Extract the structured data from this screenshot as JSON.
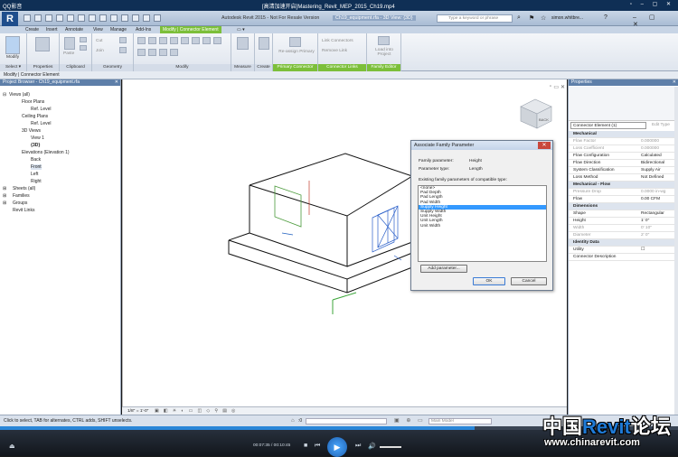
{
  "player": {
    "title": "[高清加速开启]Mastering_Revit_MEP_2015_Ch19.mp4",
    "logo": "QQ影音",
    "time": "00:07:35 / 00:10:45",
    "progress": 0.7
  },
  "revit": {
    "title": "Autodesk Revit 2015 - Not For Resale Version",
    "file_title": "Ch19_equipment.rfa - 3D View: {3D}",
    "search_placeholder": "Type a keyword or phrase",
    "user": "simon.whitbre..."
  },
  "ribbon": {
    "tabs": [
      "Create",
      "Insert",
      "Annotate",
      "View",
      "Manage",
      "Add-Ins",
      "Modify | Connector Element"
    ],
    "panels": {
      "select": "Select ▾",
      "properties": "Properties",
      "clipboard": "Clipboard",
      "geometry": "Geometry",
      "modify": "Modify",
      "measure": "Measure",
      "create": "Create",
      "primary_connector": "Primary Connector",
      "connector_links": "Connector Links",
      "family_editor": "Family Editor"
    },
    "buttons": {
      "modify": "Modify",
      "paste": "Paste",
      "cut": "Cut",
      "join": "Join",
      "reassign": "Re-assign Primary",
      "link": "Link Connectors",
      "remove_link": "Remove Link",
      "load": "Load into Project"
    }
  },
  "context_bar": "Modify | Connector Element",
  "browser": {
    "header": "Project Browser - Ch19_equipment.rfa",
    "items": [
      {
        "label": "Views (all)"
      },
      {
        "label": "Floor Plans"
      },
      {
        "label": "Ref. Level"
      },
      {
        "label": "Ceiling Plans"
      },
      {
        "label": "Ref. Level"
      },
      {
        "label": "3D Views"
      },
      {
        "label": "View 1"
      },
      {
        "label": "{3D}"
      },
      {
        "label": "Elevations (Elevation 1)"
      },
      {
        "label": "Back"
      },
      {
        "label": "Front"
      },
      {
        "label": "Left"
      },
      {
        "label": "Right"
      },
      {
        "label": "Sheets (all)"
      },
      {
        "label": "Families"
      },
      {
        "label": "Groups"
      },
      {
        "label": "Revit Links"
      }
    ]
  },
  "dialog": {
    "title": "Associate Family Parameter",
    "family_parameter_label": "Family parameter:",
    "family_parameter_value": "Height",
    "parameter_type_label": "Parameter type:",
    "parameter_type_value": "Length",
    "list_label": "Existing family parameters of compatible type:",
    "list": [
      "<none>",
      "Pad Depth",
      "Pad Length",
      "Pad Width",
      "Supply Height",
      "Supply Width",
      "Unit Height",
      "Unit Length",
      "Unit Width"
    ],
    "selected_index": 4,
    "add_button": "Add parameter...",
    "ok": "OK",
    "cancel": "Cancel"
  },
  "view_cube": {
    "face": "BACK"
  },
  "view_bar": {
    "scale": "1/8\" = 1'-0\""
  },
  "properties": {
    "header": "Properties",
    "type_selector": "Connector Element (1)",
    "edit_type": "Edit Type",
    "rows": [
      {
        "k": "Mechanical",
        "v": "",
        "sec": true
      },
      {
        "k": "Flow Factor",
        "v": "0.000000",
        "dim": true
      },
      {
        "k": "Loss Coefficient",
        "v": "0.000000",
        "dim": true
      },
      {
        "k": "Flow Configuration",
        "v": "Calculated"
      },
      {
        "k": "Flow Direction",
        "v": "Bidirectional"
      },
      {
        "k": "System Classification",
        "v": "Supply Air"
      },
      {
        "k": "Loss Method",
        "v": "Not Defined"
      },
      {
        "k": "Mechanical - Flow",
        "v": "",
        "sec": true
      },
      {
        "k": "Pressure Drop",
        "v": "0.0000 in-wg",
        "dim": true
      },
      {
        "k": "Flow",
        "v": "0.00 CFM"
      },
      {
        "k": "Dimensions",
        "v": "",
        "sec": true
      },
      {
        "k": "Shape",
        "v": "Rectangular"
      },
      {
        "k": "Height",
        "v": "1' 0\""
      },
      {
        "k": "Width",
        "v": "0' 10\"",
        "dim": true
      },
      {
        "k": "Diameter",
        "v": "2' 0\"",
        "dim": true
      },
      {
        "k": "Identity Data",
        "v": "",
        "sec": true
      },
      {
        "k": "Utility",
        "v": "☐"
      },
      {
        "k": "Connector Description",
        "v": ""
      }
    ]
  },
  "status": {
    "text": "Click to select, TAB for alternates, CTRL adds, SHIFT unselects.",
    "model": "Main Model",
    "zero": ":0"
  },
  "watermark": {
    "cn_1": "中国",
    "cn_2": "Revit",
    "cn_3": "论坛",
    "url": "www.chinarevit.com"
  }
}
